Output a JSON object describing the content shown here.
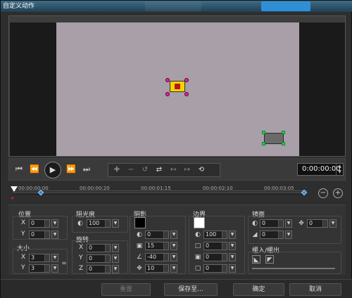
{
  "window": {
    "title": "自定义动作"
  },
  "controls": {
    "timecode": "0:00:00:00"
  },
  "timeline": {
    "labels": [
      "00:00:00:00",
      "00:00:00:20",
      "00:00:01:15",
      "00:00:02:10",
      "00:00:03:05"
    ]
  },
  "panels": {
    "position": {
      "title": "位置",
      "x_label": "X",
      "y_label": "Y",
      "x": "0",
      "y": "0"
    },
    "size": {
      "title": "大小",
      "x_label": "X",
      "y_label": "Y",
      "x": "3",
      "y": "3"
    },
    "opacity": {
      "title": "阻光度",
      "value": "100"
    },
    "rotation": {
      "title": "旋转",
      "x_label": "X",
      "y_label": "Y",
      "z_label": "Z",
      "x": "0",
      "y": "0",
      "z": "0"
    },
    "shadow": {
      "title": "阴影",
      "color": "#000000",
      "opacity": "0",
      "blur": "15",
      "angle": "-40",
      "distance": "10"
    },
    "border": {
      "title": "边界",
      "color": "#ffffff",
      "opacity": "100",
      "v1": "0",
      "v2": "0",
      "v3": "0"
    },
    "mirror": {
      "title": "镜面",
      "v1": "0",
      "v2": "0",
      "v3": "0"
    },
    "ease": {
      "title": "缓入/缓出"
    }
  },
  "footer": {
    "reset": "重置",
    "save_as": "保存至...",
    "ok": "确定",
    "cancel": "取消"
  }
}
